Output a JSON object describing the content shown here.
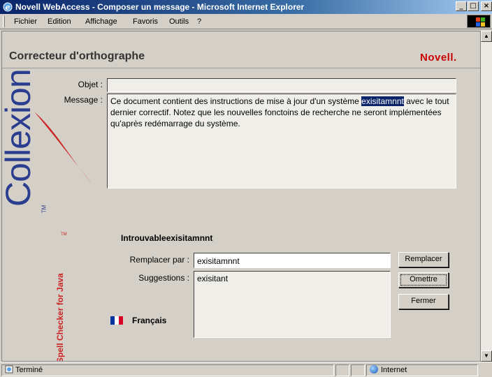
{
  "window": {
    "title": "Novell WebAccess - Composer un message - Microsoft Internet Explorer",
    "min_glyph": "_",
    "max_glyph": "□",
    "close_glyph": "×",
    "app_icon": "ie-icon"
  },
  "menu": {
    "items": [
      {
        "label": "Fichier"
      },
      {
        "label": "Edition"
      },
      {
        "label": "Affichage"
      },
      {
        "label": "Favoris"
      },
      {
        "label": "Outils"
      },
      {
        "label": "?"
      }
    ]
  },
  "banner": {
    "title": "Correcteur d'orthographe",
    "brand": "Novell."
  },
  "form": {
    "subject_label": "Objet :",
    "subject_value": "",
    "message_label": "Message :",
    "message_before": "Ce document contient des instructions de mise à jour d'un système ",
    "message_highlight": "exisitamnnt",
    "message_after": "avec le tout dernier correctif. Notez que les nouvelles fonctoins de recherche ne seront implémentées qu'après redémarrage du système."
  },
  "logo": {
    "word": "Collexion",
    "tm": "TM",
    "tagline": "Spell Checker for Java",
    "tagline_tm": "TM"
  },
  "spell": {
    "not_found_prefix": "Introuvable",
    "not_found_word": "exisitamnnt",
    "replace_label": "Remplacer par :",
    "replace_value": "exisitamnnt",
    "suggestions_label": "Suggestions :",
    "suggestions": [
      "exisitant"
    ],
    "btn_replace": "Remplacer",
    "btn_ignore": "Omettre",
    "btn_close": "Fermer"
  },
  "language": {
    "label": "Français",
    "colors": [
      "#0033a0",
      "#ffffff",
      "#d80027"
    ]
  },
  "status": {
    "left_text": "Terminé",
    "zone_text": "Internet"
  },
  "colors": {
    "brand_red": "#cc0000",
    "logo_blue": "#2a3d8f",
    "highlight": "#0a246a"
  }
}
